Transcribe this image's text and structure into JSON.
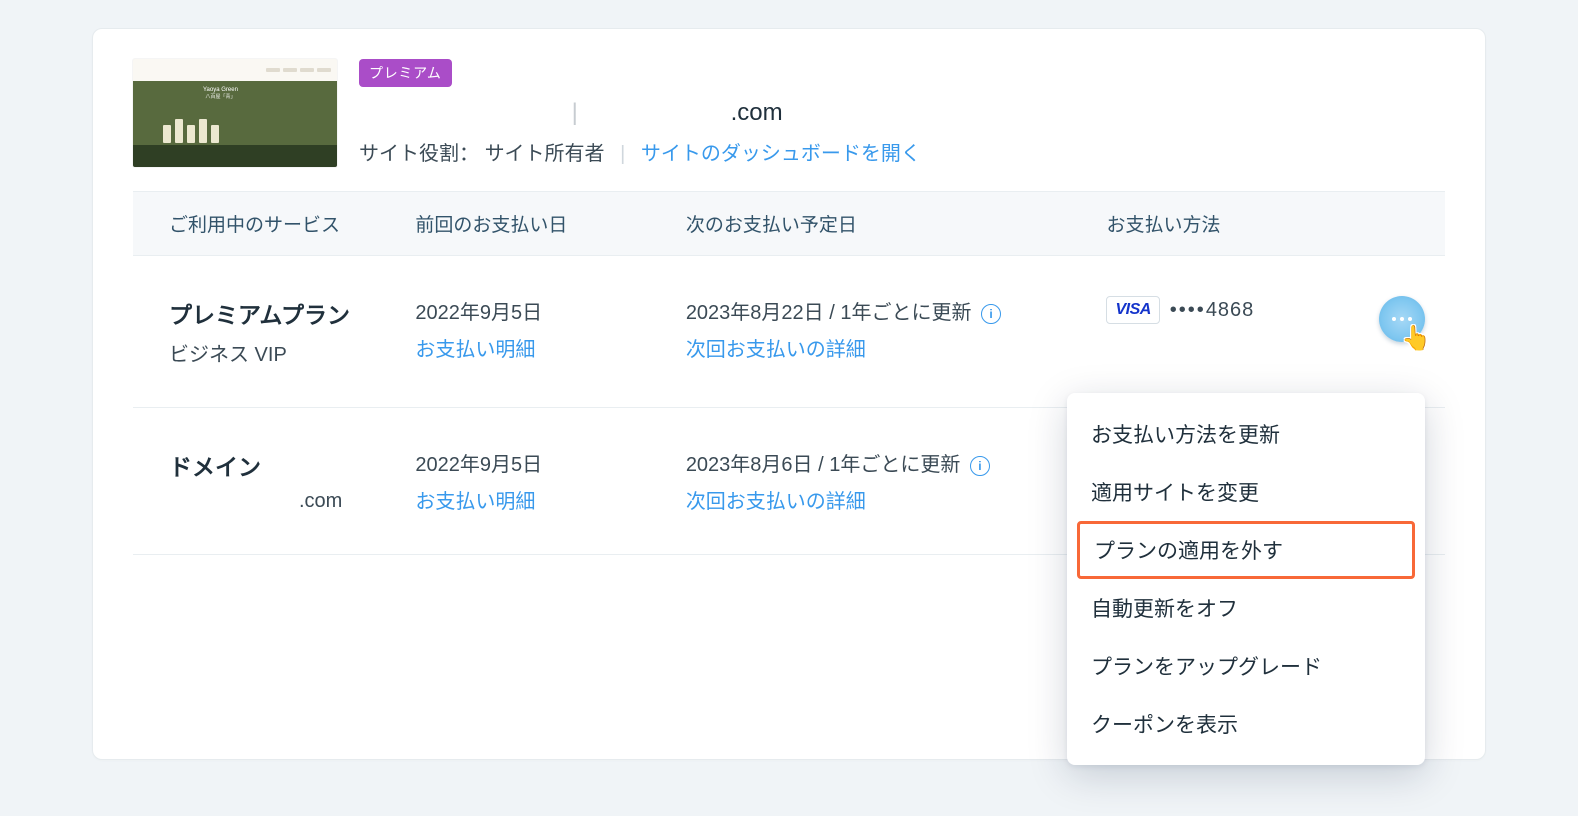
{
  "site": {
    "badge": "プレミアム",
    "domain_suffix": ".com",
    "title_separator": "|",
    "role_label": "サイト役割：",
    "role_value": "サイト所有者",
    "dashboard_link": "サイトのダッシュボードを開く"
  },
  "columns": {
    "service": "ご利用中のサービス",
    "last_payment": "前回のお支払い日",
    "next_payment": "次のお支払い予定日",
    "pay_method": "お支払い方法"
  },
  "rows": [
    {
      "service_title": "プレミアムプラン",
      "service_sub": "ビジネス VIP",
      "last_payment_date": "2022年9月5日",
      "payment_link": "お支払い明細",
      "next_payment_text": "2023年8月22日 / 1年ごとに更新",
      "next_payment_link": "次回お支払いの詳細",
      "card_brand": "VISA",
      "card_last4": "4868"
    },
    {
      "service_title": "ドメイン",
      "service_sub_suffix": ".com",
      "last_payment_date": "2022年9月5日",
      "payment_link": "お支払い明細",
      "next_payment_text": "2023年8月6日 / 1年ごとに更新",
      "next_payment_link": "次回お支払いの詳細"
    }
  ],
  "menu": {
    "items": [
      "お支払い方法を更新",
      "適用サイトを変更",
      "プランの適用を外す",
      "自動更新をオフ",
      "プランをアップグレード",
      "クーポンを表示"
    ],
    "highlight_index": 2
  }
}
